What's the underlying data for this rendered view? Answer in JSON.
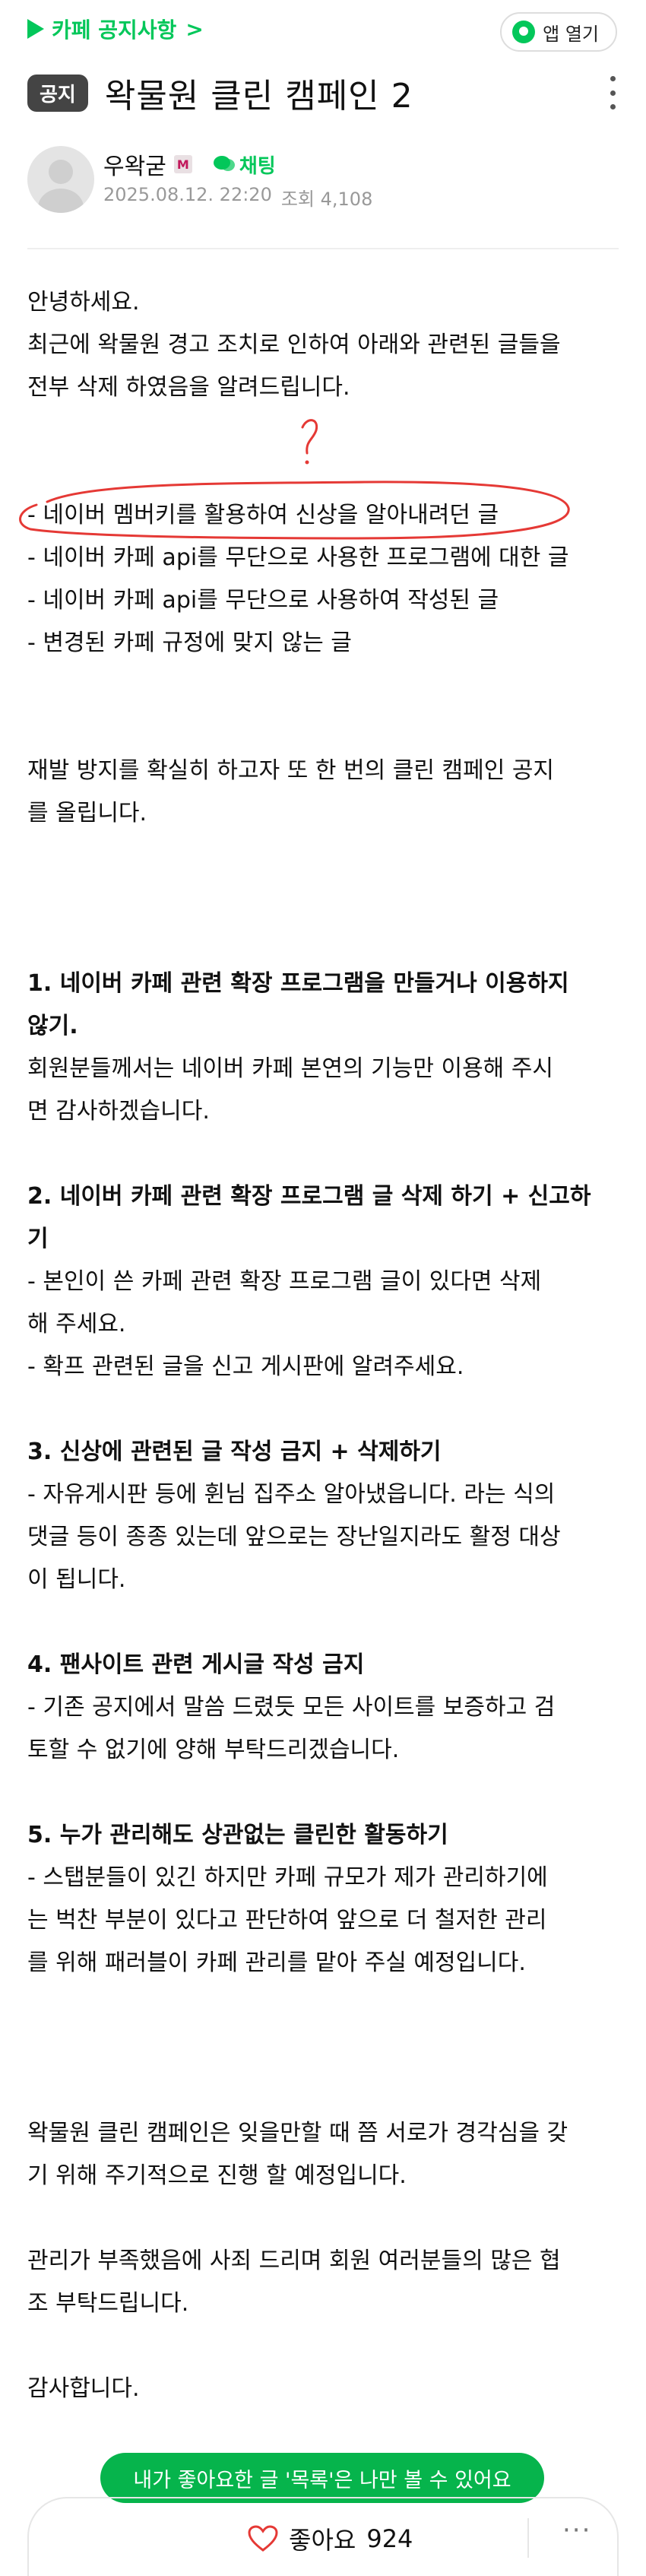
{
  "header": {
    "cafe_link": "카페 공지사항",
    "chevron": ">",
    "app_open": "앱 열기"
  },
  "post": {
    "badge": "공지",
    "title": "왁물원 클린 캠페인 2",
    "author": "우왁굳",
    "manager_mark": "M",
    "chat": "채팅",
    "date": "2025.08.12. 22:20",
    "views": "조회 4,108"
  },
  "annotation": {
    "question_mark": "?",
    "stroke_color": "#e53935"
  },
  "body": [
    "안녕하세요.",
    "최근에 왁물원 경고 조치로 인하여 아래와 관련된 글들을",
    "전부 삭제 하였음을 알려드립니다.",
    "",
    "",
    "- 네이버 멤버키를 활용하여 신상을 알아내려던 글",
    "- 네이버 카페 api를 무단으로 사용한 프로그램에 대한 글",
    "- 네이버 카페 api를 무단으로 사용하여 작성된 글",
    "- 변경된 카페 규정에 맞지 않는 글",
    "",
    "",
    "재발 방지를 확실히 하고자 또 한 번의 클린 캠페인 공지",
    "를 올립니다.",
    "",
    "",
    "",
    "1. 네이버 카페 관련 확장 프로그램을 만들거나 이용하지",
    "않기.",
    "회원분들께서는 네이버 카페 본연의 기능만 이용해 주시",
    "면 감사하겠습니다.",
    "",
    "2. 네이버 카페 관련 확장 프로그램 글 삭제 하기 + 신고하",
    "기",
    "- 본인이 쓴 카페 관련 확장 프로그램 글이 있다면 삭제",
    "해 주세요.",
    "- 확프 관련된 글을 신고 게시판에 알려주세요.",
    "",
    "3. 신상에 관련된 글 작성 금지 + 삭제하기",
    "- 자유게시판 등에 휜님 집주소 알아냈읍니다. 라는 식의",
    "댓글 등이 종종 있는데 앞으로는 장난일지라도 활정 대상",
    "이 됩니다.",
    "",
    "4. 팬사이트 관련 게시글 작성 금지",
    "- 기존 공지에서 말씀 드렸듯 모든 사이트를 보증하고 검",
    "토할 수 없기에 양해 부탁드리겠습니다.",
    "",
    "5. 누가 관리해도 상관없는 클린한 활동하기",
    "- 스탭분들이 있긴 하지만 카페 규모가 제가 관리하기에",
    "는 벅찬 부분이 있다고 판단하여 앞으로 더 철저한 관리",
    "를 위해 패러블이 카페 관리를 맡아 주실 예정입니다.",
    "",
    "",
    "",
    "왁물원 클린 캠페인은 잊을만할 때 쯤 서로가 경각심을 갖",
    "기 위해 주기적으로 진행 할 예정입니다.",
    "",
    "관리가 부족했음에 사죄 드리며 회원 여러분들의 많은 협",
    "조 부탁드립니다.",
    "",
    "감사합니다."
  ],
  "bold_lines": [
    16,
    17,
    21,
    22,
    27,
    32,
    36
  ],
  "footer": {
    "toast": "내가 좋아요한 글 '목록'은 나만 볼 수 있어요",
    "like_label": "좋아요",
    "like_count": "924",
    "more": "···"
  },
  "colors": {
    "brand_green": "#03c75a",
    "toast_green": "#06b44c",
    "badge_bg": "#444444",
    "meta_gray": "#999999"
  }
}
